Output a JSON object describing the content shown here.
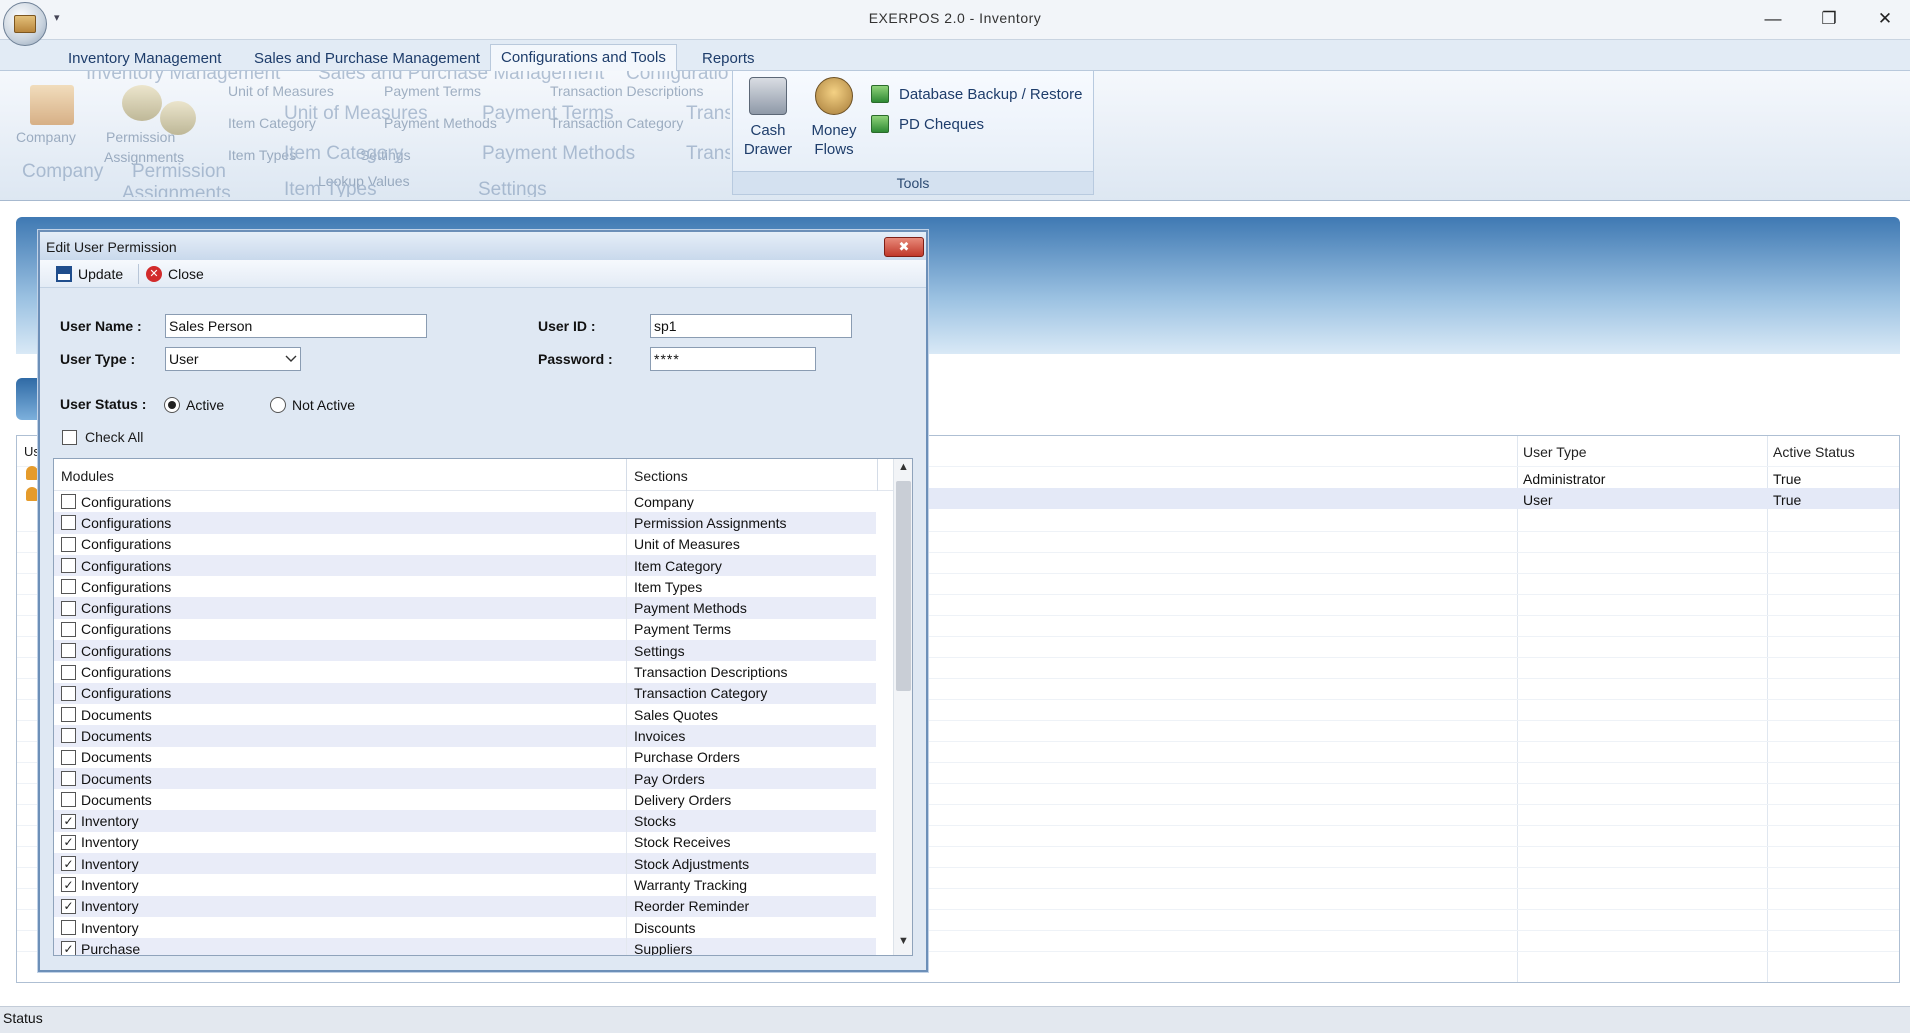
{
  "window": {
    "title": "EXERPOS 2.0 - Inventory",
    "minimize": "—",
    "restore": "❐",
    "close": "✕",
    "qat": "▾"
  },
  "ribbon": {
    "tabs": [
      {
        "label": "Inventory Management",
        "active": false
      },
      {
        "label": "Sales and Purchase Management",
        "active": false
      },
      {
        "label": "Configurations and Tools",
        "active": true
      },
      {
        "label": "Reports",
        "active": false
      }
    ],
    "ghost_labels": {
      "inventory_management": "Inventory Management",
      "sales_purchase": "Sales and Purchase Management",
      "configuration": "Configuratio",
      "unit_of_measures": "Unit of Measures",
      "payment_terms": "Payment Terms",
      "transaction_descriptions": "Transaction Descriptions",
      "company": "Company",
      "permission": "Permission",
      "assignments": "Assignments",
      "item_category": "Item Category",
      "payment_methods": "Payment Methods",
      "transaction_category": "Transaction Category",
      "trans": "Trans",
      "item_types": "Item Types",
      "settings": "Settings",
      "lookup_values": "Lookup Values",
      "big_unit_of_measures": "Unit of Measures",
      "big_payment_terms": "Payment Terms",
      "big_item_category": "Item Category",
      "big_payment_methods": "Payment Methods",
      "big_company": "Company",
      "big_permission": "Permission",
      "big_item_types": "Item Types",
      "big_settings": "Settings",
      "big_trans": "Trans",
      "big_trans2": "Trans",
      "big_assignments": "Assignments"
    },
    "tools": {
      "group_label": "Tools",
      "cash_drawer_line1": "Cash",
      "cash_drawer_line2": "Drawer",
      "money_flows_line1": "Money",
      "money_flows_line2": "Flows",
      "db_backup": "Database Backup / Restore",
      "pd_cheques": "PD Cheques"
    }
  },
  "users_grid": {
    "left_header": "Us",
    "columns": [
      "User Type",
      "Active Status"
    ],
    "rows": [
      {
        "user_type": "Administrator",
        "active_status": "True"
      },
      {
        "user_type": "User",
        "active_status": "True"
      }
    ]
  },
  "status_bar": {
    "text": "Status"
  },
  "dialog": {
    "title": "Edit User Permission",
    "close_glyph": "✖",
    "toolbar": {
      "update": "Update",
      "close": "Close",
      "close_icon": "✕"
    },
    "form": {
      "username_label": "User Name :",
      "username_value": "Sales Person",
      "userid_label": "User ID :",
      "userid_value": "sp1",
      "usertype_label": "User Type :",
      "usertype_value": "User",
      "password_label": "Password :",
      "password_value": "****",
      "status_label": "User Status :",
      "status_active": "Active",
      "status_not_active": "Not Active",
      "selected_status": "Active",
      "check_all": "Check All"
    },
    "grid": {
      "headers": {
        "modules": "Modules",
        "sections": "Sections"
      },
      "rows": [
        {
          "module": "Configurations",
          "section": "Company",
          "checked": false
        },
        {
          "module": "Configurations",
          "section": "Permission Assignments",
          "checked": false
        },
        {
          "module": "Configurations",
          "section": "Unit of Measures",
          "checked": false
        },
        {
          "module": "Configurations",
          "section": "Item Category",
          "checked": false
        },
        {
          "module": "Configurations",
          "section": "Item Types",
          "checked": false
        },
        {
          "module": "Configurations",
          "section": "Payment Methods",
          "checked": false
        },
        {
          "module": "Configurations",
          "section": "Payment Terms",
          "checked": false
        },
        {
          "module": "Configurations",
          "section": "Settings",
          "checked": false
        },
        {
          "module": "Configurations",
          "section": "Transaction Descriptions",
          "checked": false
        },
        {
          "module": "Configurations",
          "section": "Transaction Category",
          "checked": false
        },
        {
          "module": "Documents",
          "section": "Sales Quotes",
          "checked": false
        },
        {
          "module": "Documents",
          "section": "Invoices",
          "checked": false
        },
        {
          "module": "Documents",
          "section": "Purchase Orders",
          "checked": false
        },
        {
          "module": "Documents",
          "section": "Pay Orders",
          "checked": false
        },
        {
          "module": "Documents",
          "section": "Delivery Orders",
          "checked": false
        },
        {
          "module": "Inventory",
          "section": "Stocks",
          "checked": true
        },
        {
          "module": "Inventory",
          "section": "Stock Receives",
          "checked": true
        },
        {
          "module": "Inventory",
          "section": "Stock Adjustments",
          "checked": true
        },
        {
          "module": "Inventory",
          "section": "Warranty Tracking",
          "checked": true
        },
        {
          "module": "Inventory",
          "section": "Reorder Reminder",
          "checked": true
        },
        {
          "module": "Inventory",
          "section": "Discounts",
          "checked": false
        },
        {
          "module": "Purchase",
          "section": "Suppliers",
          "checked": true
        }
      ]
    }
  }
}
